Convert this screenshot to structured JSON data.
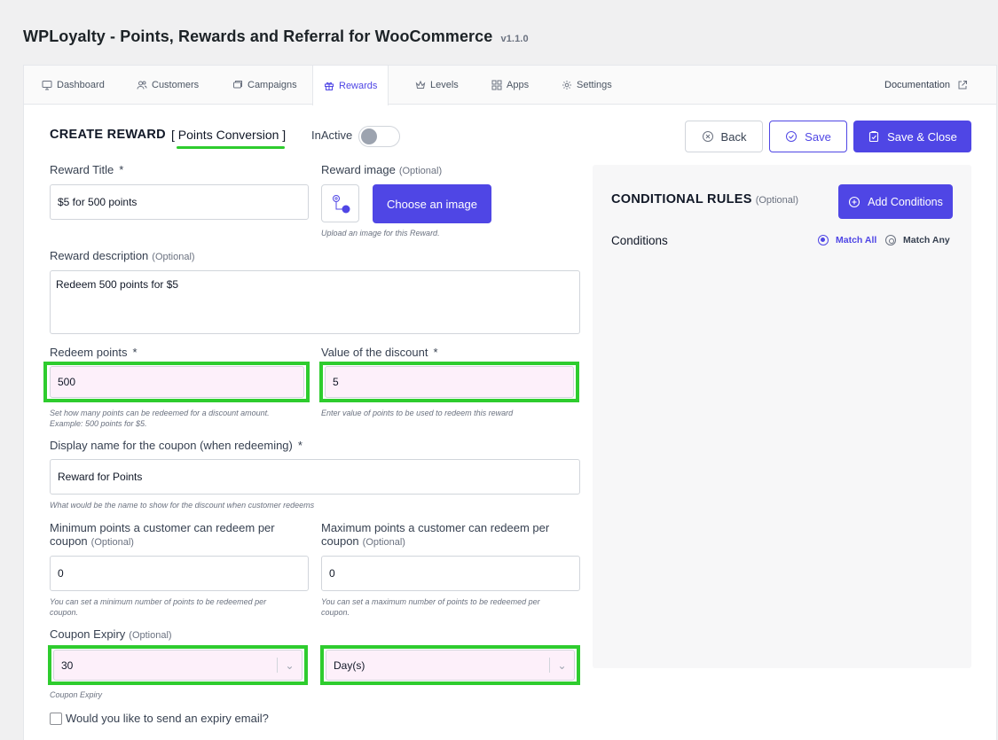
{
  "app": {
    "title": "WPLoyalty - Points, Rewards and Referral for WooCommerce",
    "version": "v1.1.0"
  },
  "tabs": [
    {
      "label": "Dashboard",
      "icon": "monitor-icon"
    },
    {
      "label": "Customers",
      "icon": "users-icon"
    },
    {
      "label": "Campaigns",
      "icon": "tag-icon"
    },
    {
      "label": "Rewards",
      "icon": "gift-icon",
      "active": true
    },
    {
      "label": "Levels",
      "icon": "crown-icon"
    },
    {
      "label": "Apps",
      "icon": "grid-icon"
    },
    {
      "label": "Settings",
      "icon": "gear-icon"
    }
  ],
  "documentation": {
    "label": "Documentation",
    "icon": "external-link-icon"
  },
  "form": {
    "heading": "CREATE REWARD",
    "reward_type": "[ Points Conversion ]",
    "status_label": "InActive",
    "status_active": false,
    "back_label": "Back",
    "save_label": "Save",
    "save_close_label": "Save & Close",
    "reward_title": {
      "label": "Reward Title",
      "req": "*",
      "value": "$5 for 500 points"
    },
    "reward_image": {
      "label": "Reward image",
      "opt": "(Optional)",
      "button": "Choose an image",
      "hint": "Upload an image for this Reward."
    },
    "reward_description": {
      "label": "Reward description",
      "opt": "(Optional)",
      "value": "Redeem 500 points for $5"
    },
    "redeem_points": {
      "label": "Redeem points",
      "req": "*",
      "value": "500",
      "hint_line1": "Set how many points can be redeemed for a discount amount.",
      "hint_line2": "Example: 500 points for $5."
    },
    "discount_value": {
      "label": "Value of the discount",
      "req": "*",
      "value": "5",
      "hint": "Enter value of points to be used to redeem this reward"
    },
    "coupon_name": {
      "label": "Display name for the coupon (when redeeming)",
      "req": "*",
      "value": "Reward for Points",
      "hint": "What would be the name to show for the discount when customer redeems"
    },
    "min_points": {
      "label_line1": "Minimum points a customer can redeem per",
      "label_line2": "coupon",
      "opt": "(Optional)",
      "value": "0",
      "hint_line1": "You can set a minimum number of points to be redeemed per",
      "hint_line2": "coupon."
    },
    "max_points": {
      "label_line1": "Maximum points a customer can redeem per",
      "label_line2": "coupon",
      "opt": "(Optional)",
      "value": "0",
      "hint_line1": "You can set a maximum number of points to be redeemed per",
      "hint_line2": "coupon."
    },
    "coupon_expiry": {
      "label": "Coupon Expiry",
      "opt": "(Optional)",
      "value": "30",
      "unit": "Day(s)",
      "hint": "Coupon Expiry"
    },
    "expiry_email": {
      "label": "Would you like to send an expiry email?",
      "checked": false
    }
  },
  "conditions": {
    "title": "CONDITIONAL RULES",
    "opt": "(Optional)",
    "add_label": "Add Conditions",
    "conditions_label": "Conditions",
    "match_all": "Match All",
    "match_any": "Match Any",
    "selected": "Match All"
  },
  "colors": {
    "accent": "#4f46e5",
    "highlight": "#2ecc2e",
    "input_highlight_bg": "#fdf0fa"
  }
}
